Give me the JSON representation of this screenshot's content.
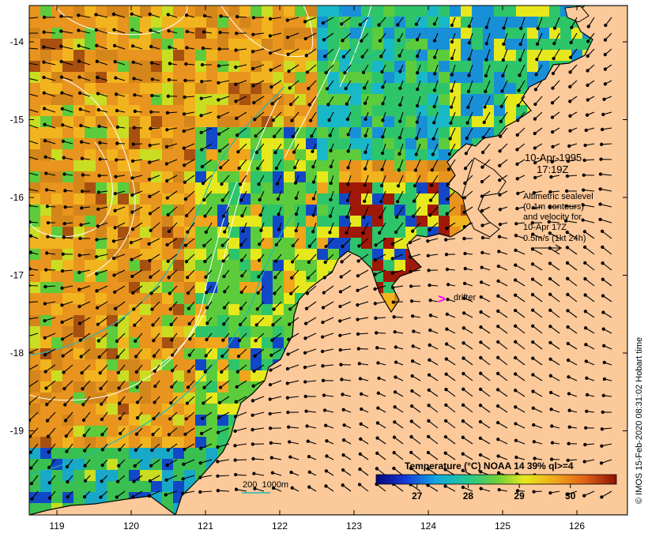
{
  "map": {
    "axis": {
      "x_ticks": [
        "119",
        "120",
        "121",
        "122",
        "123",
        "124",
        "125",
        "126"
      ],
      "y_ticks": [
        "-14",
        "-15",
        "-16",
        "-17",
        "-18",
        "-19"
      ]
    },
    "annotations": {
      "date": "10-Apr-1995",
      "time": "17:19Z",
      "legend_lines": [
        "Altimetric sealevel",
        "(0.1m contours)",
        "and velocity for",
        "10-Apr 17Z",
        "0.5m/s (1kt 24h)"
      ],
      "drifter_symbol": ">",
      "drifter_label": "drifter",
      "bathymetry_label": "200  1000m"
    },
    "colorbar": {
      "title": "Temperature (°C) NOAA 14 39% ql>=4",
      "ticks": [
        "27",
        "28",
        "29",
        "30"
      ],
      "tick_values": [
        27,
        28,
        29,
        30
      ],
      "range": [
        26.2,
        30.9
      ]
    },
    "credit": "© IMOS 15-Feb-2020 08:31:02 Hobart time",
    "colors": {
      "land": "#fcc99a",
      "drifter": "#ff00ff",
      "isobath": "#1fb8b8",
      "contour": "#ffffff"
    }
  }
}
